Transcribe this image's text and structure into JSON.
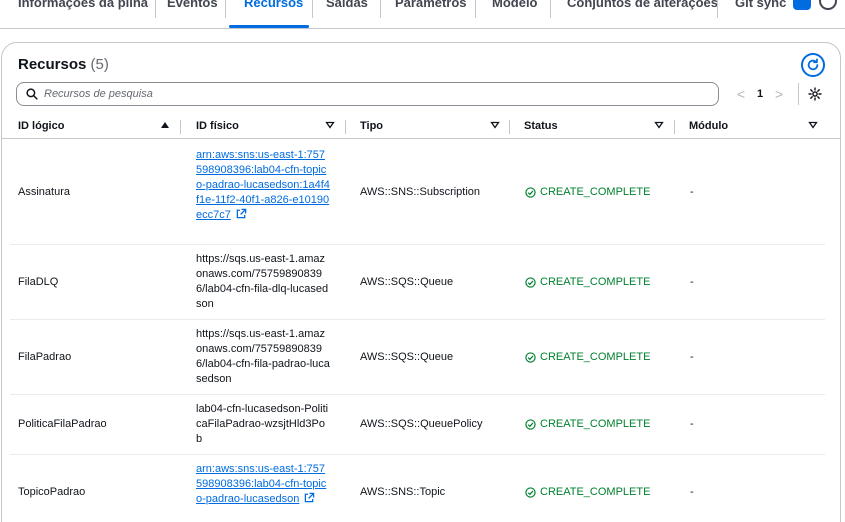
{
  "tabs": [
    {
      "label": "Informações da pilha"
    },
    {
      "label": "Eventos"
    },
    {
      "label": "Recursos"
    },
    {
      "label": "Saídas"
    },
    {
      "label": "Parâmetros"
    },
    {
      "label": "Modelo"
    },
    {
      "label": "Conjuntos de alterações"
    },
    {
      "label": "Git sync"
    }
  ],
  "panel": {
    "title": "Recursos",
    "count": "(5)"
  },
  "search": {
    "placeholder": "Recursos de pesquisa"
  },
  "pagination": {
    "prev": "<",
    "current_page": "1",
    "next": ">"
  },
  "table": {
    "columns": [
      {
        "label": "ID lógico"
      },
      {
        "label": "ID físico"
      },
      {
        "label": "Tipo"
      },
      {
        "label": "Status"
      },
      {
        "label": "Módulo"
      }
    ],
    "rows": [
      {
        "logical_id": "Assinatura",
        "physical_id": "arn:aws:sns:us-east-1:757598908396:lab04-cfn-topico-padrao-lucasedson:1a4f4f1e-11f2-40f1-a826-e10190ecc7c7",
        "physical_is_link": true,
        "type": "AWS::SNS::Subscription",
        "status": "CREATE_COMPLETE",
        "module": "-"
      },
      {
        "logical_id": "FilaDLQ",
        "physical_id": "https://sqs.us-east-1.amazonaws.com/757598908396/lab04-cfn-fila-dlq-lucasedson",
        "physical_is_link": false,
        "type": "AWS::SQS::Queue",
        "status": "CREATE_COMPLETE",
        "module": "-"
      },
      {
        "logical_id": "FilaPadrao",
        "physical_id": "https://sqs.us-east-1.amazonaws.com/757598908396/lab04-cfn-fila-padrao-lucasedson",
        "physical_is_link": false,
        "type": "AWS::SQS::Queue",
        "status": "CREATE_COMPLETE",
        "module": "-"
      },
      {
        "logical_id": "PoliticaFilaPadrao",
        "physical_id": "lab04-cfn-lucasedson-PoliticaFilaPadrao-wzsjtHld3Pob",
        "physical_is_link": false,
        "type": "AWS::SQS::QueuePolicy",
        "status": "CREATE_COMPLETE",
        "module": "-"
      },
      {
        "logical_id": "TopicoPadrao",
        "physical_id": "arn:aws:sns:us-east-1:757598908396:lab04-cfn-topico-padrao-lucasedson",
        "physical_is_link": true,
        "type": "AWS::SNS::Topic",
        "status": "CREATE_COMPLETE",
        "module": "-"
      }
    ]
  },
  "colors": {
    "accent": "#006ce0",
    "success": "#00802f",
    "border": "#c6c6cd"
  },
  "icons": [
    "refresh-icon",
    "search-icon",
    "settings-gear-icon",
    "sort-ascending-icon",
    "sort-descending-icon",
    "external-link-icon",
    "success-check-icon"
  ]
}
